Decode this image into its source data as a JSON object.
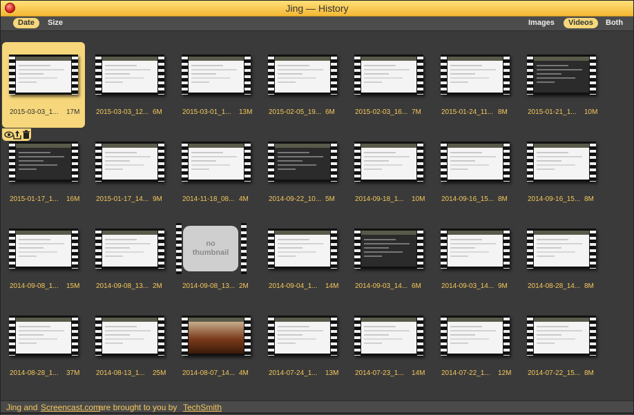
{
  "window": {
    "title": "Jing — History"
  },
  "sort": {
    "date": "Date",
    "size": "Size"
  },
  "filter": {
    "images": "Images",
    "videos": "Videos",
    "both": "Both"
  },
  "items": [
    {
      "name": "2015-03-03_1...",
      "size": "17M"
    },
    {
      "name": "2015-03-03_12...",
      "size": "6M"
    },
    {
      "name": "2015-03-01_1...",
      "size": "13M"
    },
    {
      "name": "2015-02-05_19...",
      "size": "6M"
    },
    {
      "name": "2015-02-03_16...",
      "size": "7M"
    },
    {
      "name": "2015-01-24_11...",
      "size": "8M"
    },
    {
      "name": "2015-01-21_1...",
      "size": "10M"
    },
    {
      "name": "2015-01-17_1...",
      "size": "16M"
    },
    {
      "name": "2015-01-17_14...",
      "size": "9M"
    },
    {
      "name": "2014-11-18_08...",
      "size": "4M"
    },
    {
      "name": "2014-09-22_10...",
      "size": "5M"
    },
    {
      "name": "2014-09-18_1...",
      "size": "10M"
    },
    {
      "name": "2014-09-16_15...",
      "size": "8M"
    },
    {
      "name": "2014-09-16_15...",
      "size": "8M"
    },
    {
      "name": "2014-09-08_1...",
      "size": "15M"
    },
    {
      "name": "2014-09-08_13...",
      "size": "2M"
    },
    {
      "name": "2014-09-08_13...",
      "size": "2M",
      "no_thumb": "no\nthumbnail"
    },
    {
      "name": "2014-09-04_1...",
      "size": "14M"
    },
    {
      "name": "2014-09-03_14...",
      "size": "6M"
    },
    {
      "name": "2014-09-03_14...",
      "size": "9M"
    },
    {
      "name": "2014-08-28_14...",
      "size": "8M"
    },
    {
      "name": "2014-08-28_1...",
      "size": "37M"
    },
    {
      "name": "2014-08-13_1...",
      "size": "25M"
    },
    {
      "name": "2014-08-07_14...",
      "size": "4M"
    },
    {
      "name": "2014-07-24_1...",
      "size": "13M"
    },
    {
      "name": "2014-07-23_1...",
      "size": "14M"
    },
    {
      "name": "2014-07-22_1...",
      "size": "12M"
    },
    {
      "name": "2014-07-22_15...",
      "size": "8M"
    }
  ],
  "selected_actions": [
    "eye-icon",
    "share-icon",
    "trash-icon"
  ],
  "footer": {
    "part1": "Jing and ",
    "link1": "Screencast.com",
    "part2": " are brought to you by ",
    "link2": "TechSmith"
  },
  "colors": {
    "accent": "#f7d77b",
    "label": "#f5c85c"
  }
}
